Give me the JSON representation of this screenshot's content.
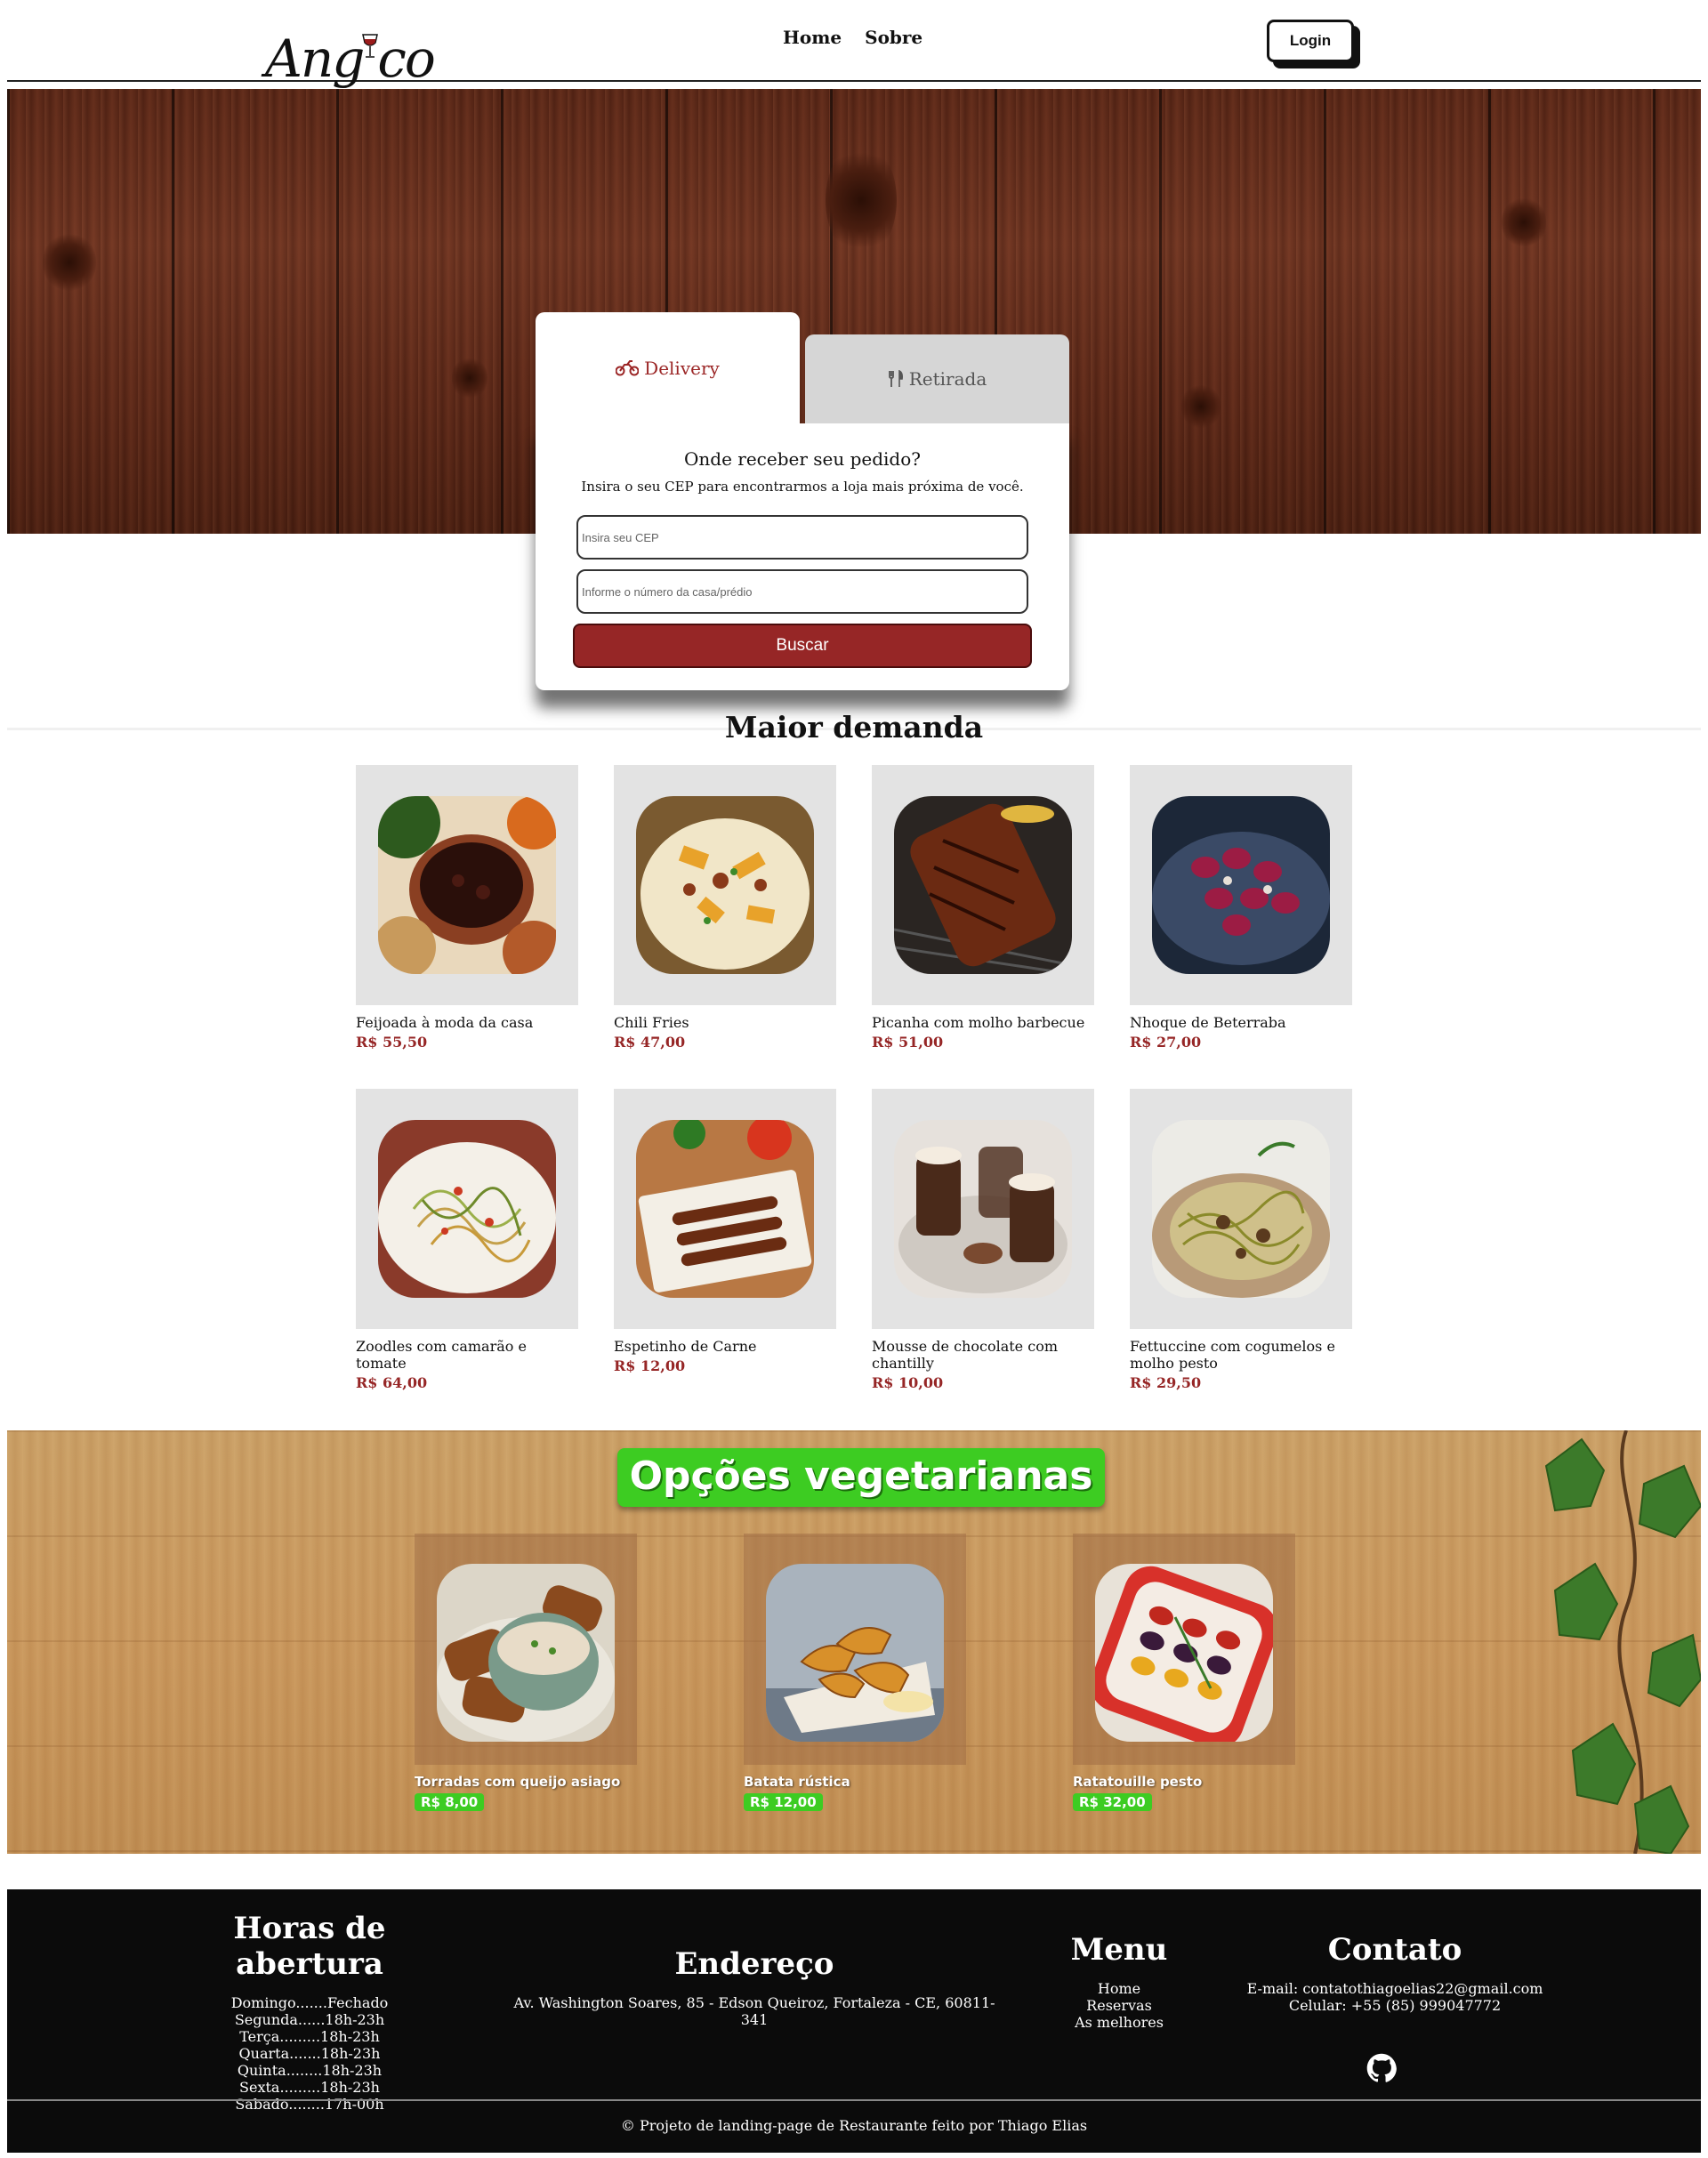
{
  "header": {
    "logo_text_left": "Ang",
    "logo_text_right": "co",
    "nav": [
      "Home",
      "Sobre"
    ],
    "login_label": "Login"
  },
  "order": {
    "tab_delivery": "Delivery",
    "tab_retirada": "Retirada",
    "title": "Onde receber seu pedido?",
    "subtitle": "Insira o seu CEP para encontrarmos a loja mais próxima de você.",
    "cep_placeholder": "Insira seu CEP",
    "numero_placeholder": "Informe o número da casa/prédio",
    "buscar_label": "Buscar"
  },
  "demanda": {
    "title": "Maior demanda",
    "items": [
      {
        "name": "Feijoada à moda da casa",
        "price": "R$ 55,50"
      },
      {
        "name": "Chili Fries",
        "price": "R$ 47,00"
      },
      {
        "name": "Picanha com molho barbecue",
        "price": "R$ 51,00"
      },
      {
        "name": "Nhoque de Beterraba",
        "price": "R$ 27,00"
      },
      {
        "name": "Zoodles com camarão e tomate",
        "price": "R$ 64,00"
      },
      {
        "name": "Espetinho de Carne",
        "price": "R$ 12,00"
      },
      {
        "name": "Mousse de chocolate com chantilly",
        "price": "R$ 10,00"
      },
      {
        "name": "Fettuccine com cogumelos e molho pesto",
        "price": "R$ 29,50"
      }
    ]
  },
  "vegetariano": {
    "title": "Opções vegetarianas",
    "items": [
      {
        "name": "Torradas com queijo asiago",
        "price": "R$ 8,00"
      },
      {
        "name": "Batata rústica",
        "price": "R$ 12,00"
      },
      {
        "name": "Ratatouille pesto",
        "price": "R$ 32,00"
      }
    ]
  },
  "footer": {
    "hours_title": "Horas de abertura",
    "hours": [
      "Domingo.......Fechado",
      "Segunda......18h-23h",
      "Terça.........18h-23h",
      "Quarta.......18h-23h",
      "Quinta........18h-23h",
      "Sexta.........18h-23h",
      "Sabado........17h-00h"
    ],
    "address_title": "Endereço",
    "address": "Av. Washington Soares, 85 - Edson Queiroz, Fortaleza - CE, 60811-341",
    "menu_title": "Menu",
    "menu": [
      "Home",
      "Reservas",
      "As melhores"
    ],
    "contact_title": "Contato",
    "email": "E-mail: contatothiagoelias22@gmail.com",
    "phone": "Celular: +55 (85) 999047772",
    "copyright": "© Projeto de landing-page de Restaurante feito por Thiago Elias"
  },
  "colors": {
    "accent_red": "#962626",
    "veg_green": "#3dcc22",
    "footer_bg": "#0b0b0b",
    "tile_gray": "#e3e3e3"
  },
  "icons": [
    "wine-glass-icon",
    "motorcycle-icon",
    "utensils-icon",
    "github-icon"
  ]
}
